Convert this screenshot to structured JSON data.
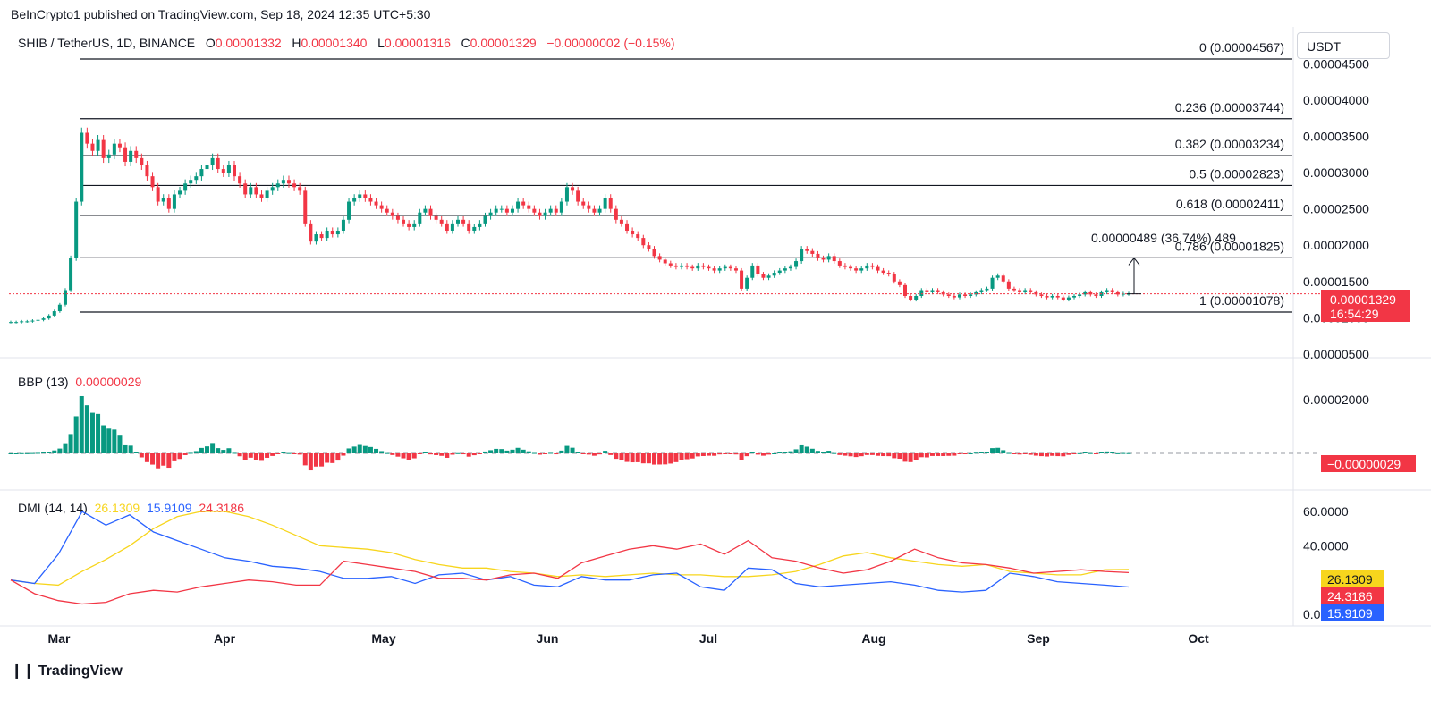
{
  "header": {
    "published": "BeInCrypto1 published on TradingView.com, Sep 18, 2024 12:35 UTC+5:30"
  },
  "legend": {
    "symbol": "SHIB / TetherUS, 1D, BINANCE",
    "open_label": "O",
    "open": "0.00001332",
    "high_label": "H",
    "high": "0.00001340",
    "low_label": "L",
    "low": "0.00001316",
    "close_label": "C",
    "close": "0.00001329",
    "change": "−0.00000002 (−0.15%)"
  },
  "currency_button": "USDT",
  "bbp_legend": {
    "name": "BBP (13)",
    "value": "0.00000029"
  },
  "dmi_legend": {
    "name": "DMI (14, 14)",
    "adx": "26.1309",
    "plus_di": "15.9109",
    "minus_di": "24.3186"
  },
  "price_badge": {
    "price": "0.00001329",
    "countdown": "16:54:29"
  },
  "bbp_badge": "−0.00000029",
  "dmi_badges": {
    "adx": "26.1309",
    "minus_di": "24.3186",
    "plus_di": "15.9109"
  },
  "measure_label": "0.00000489 (36.74%) 489",
  "brand": "TradingView",
  "colors": {
    "up": "#089981",
    "down": "#f23645",
    "adx": "#f7d51d",
    "plus_di": "#2962ff",
    "minus_di": "#f23645",
    "fib_line": "#131722"
  },
  "chart_data": [
    {
      "type": "candlestick",
      "title": "SHIB / TetherUS, 1D, BINANCE",
      "y_axis_ticks": [
        "0.00004500",
        "0.00004000",
        "0.00003500",
        "0.00003000",
        "0.00002500",
        "0.00002000",
        "0.00001500",
        "0.00001000",
        "0.00000500"
      ],
      "y_tick_values": [
        4.5e-05,
        4e-05,
        3.5e-05,
        3e-05,
        2.5e-05,
        2e-05,
        1.5e-05,
        1e-05,
        5e-06
      ],
      "ylim": [
        4.5e-06,
        4.8e-05
      ],
      "x_axis_ticks": [
        "Mar",
        "Apr",
        "May",
        "Jun",
        "Jul",
        "Aug",
        "Sep",
        "Oct"
      ],
      "fibonacci": [
        {
          "level": "0",
          "price": "0.00004567",
          "value": 4.567e-05
        },
        {
          "level": "0.236",
          "price": "0.00003744",
          "value": 3.744e-05
        },
        {
          "level": "0.382",
          "price": "0.00003234",
          "value": 3.234e-05
        },
        {
          "level": "0.5",
          "price": "0.00002823",
          "value": 2.823e-05
        },
        {
          "level": "0.618",
          "price": "0.00002411",
          "value": 2.411e-05
        },
        {
          "level": "0.786",
          "price": "0.00001825",
          "value": 1.825e-05
        },
        {
          "level": "1",
          "price": "0.00001078",
          "value": 1.078e-05
        }
      ],
      "last_price": 1.329e-05,
      "measure": {
        "from": 1.329e-05,
        "to": 1.825e-05
      },
      "closes": [
        9.4e-06,
        9.4e-06,
        9.5e-06,
        9.5e-06,
        9.6e-06,
        9.7e-06,
        9.9e-06,
        1.03e-05,
        1.09e-05,
        1.18e-05,
        1.38e-05,
        1.82e-05,
        2.6e-05,
        3.55e-05,
        3.4e-05,
        3.3e-05,
        3.45e-05,
        3.2e-05,
        3.25e-05,
        3.4e-05,
        3.35e-05,
        3.15e-05,
        3.3e-05,
        3.2e-05,
        3.1e-05,
        2.95e-05,
        2.8e-05,
        2.6e-05,
        2.65e-05,
        2.5e-05,
        2.7e-05,
        2.75e-05,
        2.85e-05,
        2.9e-05,
        2.95e-05,
        3.05e-05,
        3.1e-05,
        3.2e-05,
        3.05e-05,
        3e-05,
        3.1e-05,
        2.95e-05,
        2.85e-05,
        2.7e-05,
        2.8e-05,
        2.7e-05,
        2.65e-05,
        2.75e-05,
        2.8e-05,
        2.85e-05,
        2.9e-05,
        2.85e-05,
        2.8e-05,
        2.75e-05,
        2.3e-05,
        2.05e-05,
        2.15e-05,
        2.1e-05,
        2.2e-05,
        2.15e-05,
        2.2e-05,
        2.35e-05,
        2.6e-05,
        2.65e-05,
        2.7e-05,
        2.65e-05,
        2.6e-05,
        2.55e-05,
        2.5e-05,
        2.45e-05,
        2.4e-05,
        2.35e-05,
        2.3e-05,
        2.25e-05,
        2.3e-05,
        2.45e-05,
        2.5e-05,
        2.4e-05,
        2.35e-05,
        2.3e-05,
        2.2e-05,
        2.3e-05,
        2.35e-05,
        2.3e-05,
        2.2e-05,
        2.25e-05,
        2.3e-05,
        2.4e-05,
        2.45e-05,
        2.5e-05,
        2.5e-05,
        2.45e-05,
        2.5e-05,
        2.6e-05,
        2.55e-05,
        2.5e-05,
        2.45e-05,
        2.4e-05,
        2.45e-05,
        2.5e-05,
        2.45e-05,
        2.6e-05,
        2.8e-05,
        2.75e-05,
        2.6e-05,
        2.55e-05,
        2.5e-05,
        2.45e-05,
        2.5e-05,
        2.65e-05,
        2.5e-05,
        2.35e-05,
        2.3e-05,
        2.2e-05,
        2.15e-05,
        2.1e-05,
        2e-05,
        1.95e-05,
        1.85e-05,
        1.8e-05,
        1.75e-05,
        1.72e-05,
        1.7e-05,
        1.72e-05,
        1.7e-05,
        1.68e-05,
        1.72e-05,
        1.7e-05,
        1.68e-05,
        1.65e-05,
        1.68e-05,
        1.7e-05,
        1.68e-05,
        1.65e-05,
        1.4e-05,
        1.55e-05,
        1.72e-05,
        1.6e-05,
        1.55e-05,
        1.58e-05,
        1.62e-05,
        1.65e-05,
        1.68e-05,
        1.7e-05,
        1.78e-05,
        1.95e-05,
        1.92e-05,
        1.88e-05,
        1.82e-05,
        1.8e-05,
        1.85e-05,
        1.78e-05,
        1.72e-05,
        1.7e-05,
        1.68e-05,
        1.65e-05,
        1.68e-05,
        1.72e-05,
        1.7e-05,
        1.65e-05,
        1.62e-05,
        1.6e-05,
        1.5e-05,
        1.45e-05,
        1.3e-05,
        1.25e-05,
        1.3e-05,
        1.38e-05,
        1.35e-05,
        1.38e-05,
        1.35e-05,
        1.32e-05,
        1.3e-05,
        1.28e-05,
        1.32e-05,
        1.3e-05,
        1.32e-05,
        1.35e-05,
        1.38e-05,
        1.4e-05,
        1.55e-05,
        1.58e-05,
        1.5e-05,
        1.4e-05,
        1.38e-05,
        1.35e-05,
        1.38e-05,
        1.35e-05,
        1.32e-05,
        1.3e-05,
        1.28e-05,
        1.3e-05,
        1.28e-05,
        1.25e-05,
        1.28e-05,
        1.3e-05,
        1.32e-05,
        1.35e-05,
        1.32e-05,
        1.3e-05,
        1.35e-05,
        1.38e-05,
        1.35e-05,
        1.32e-05,
        1.33e-05,
        1.33e-05
      ]
    },
    {
      "type": "bar",
      "title": "BBP (13)",
      "y_axis_ticks": [
        "0.00002000"
      ],
      "y_tick_values": [
        2e-05
      ],
      "ylim": [
        -4e-06,
        1.3e-05
      ]
    },
    {
      "type": "line",
      "title": "DMI (14, 14)",
      "y_axis_ticks": [
        "60.0000",
        "40.0000",
        "0.0000"
      ],
      "y_tick_values": [
        60,
        40,
        0
      ],
      "ylim": [
        -2,
        70
      ],
      "series": [
        {
          "name": "ADX",
          "values": [
            20,
            18,
            17,
            25,
            32,
            40,
            50,
            57,
            60,
            60,
            57,
            52,
            46,
            40,
            39,
            38,
            36,
            32,
            29,
            27,
            27,
            25,
            24,
            22,
            23,
            22,
            23,
            24,
            23,
            23,
            22,
            22,
            23,
            25,
            29,
            34,
            36,
            33,
            31,
            29,
            28,
            29,
            25,
            24,
            23,
            23,
            26,
            26.1309
          ]
        },
        {
          "name": "+DI",
          "values": [
            20,
            18,
            35,
            60,
            52,
            58,
            48,
            43,
            38,
            33,
            31,
            28,
            27,
            25,
            21,
            21,
            22,
            18,
            23,
            24,
            20,
            22,
            17,
            16,
            22,
            20,
            20,
            23,
            24,
            16,
            14,
            27,
            26,
            18,
            16,
            17,
            18,
            19,
            17,
            14,
            13,
            14,
            24,
            22,
            19,
            18,
            17,
            15.9109
          ]
        },
        {
          "name": "-DI",
          "values": [
            20,
            12,
            8,
            6,
            7,
            12,
            14,
            13,
            16,
            18,
            20,
            19,
            17,
            17,
            31,
            29,
            27,
            25,
            21,
            21,
            20,
            23,
            24,
            21,
            30,
            34,
            38,
            40,
            38,
            41,
            35,
            43,
            33,
            31,
            27,
            24,
            26,
            31,
            38,
            33,
            30,
            29,
            27,
            24,
            25,
            26,
            25,
            24.3186
          ]
        }
      ]
    }
  ]
}
